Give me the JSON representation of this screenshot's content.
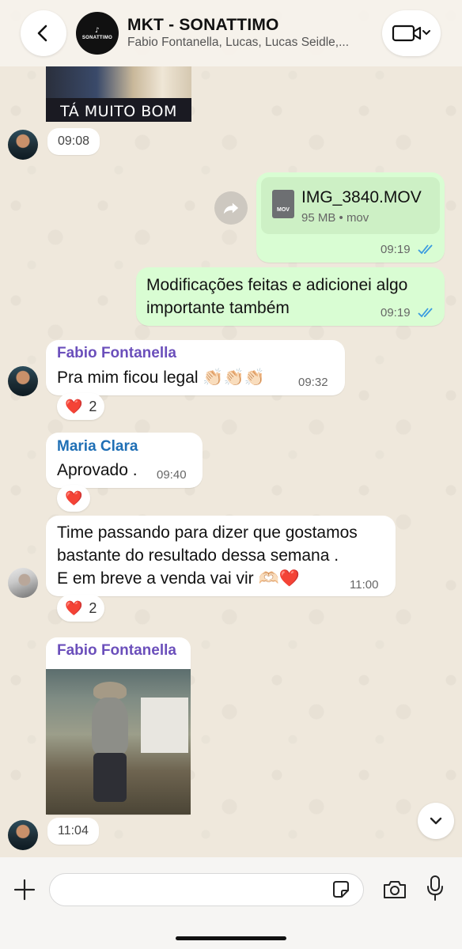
{
  "header": {
    "title": "MKT - SONATTIMO",
    "subtitle": "Fabio Fontanella, Lucas, Lucas Seidle,...",
    "avatar_text": "SONATTIMO"
  },
  "messages": {
    "gif_caption": "TÁ MUITO BOM",
    "gif_time": "09:08",
    "file": {
      "badge": "MOV",
      "name": "IMG_3840.MOV",
      "meta": "95 MB • mov",
      "time": "09:19"
    },
    "out_text": {
      "text_line1": "Modificações feitas e adicionei algo",
      "text_line2": "importante também",
      "time": "09:19"
    },
    "fabio1": {
      "sender": "Fabio Fontanella",
      "text": "Pra mim ficou legal 👏🏻👏🏻👏🏻",
      "time": "09:32",
      "reaction_emoji": "❤️",
      "reaction_count": "2"
    },
    "maria": {
      "sender": "Maria Clara",
      "text": "Aprovado .",
      "time": "09:40",
      "reaction_emoji": "❤️"
    },
    "team": {
      "line1": "Time passando para dizer que gostamos",
      "line2": "bastante do resultado dessa semana .",
      "line3": "E em breve a venda vai vir 🫶🏻❤️",
      "time": "11:00",
      "reaction_emoji": "❤️",
      "reaction_count": "2"
    },
    "fabio2": {
      "sender": "Fabio Fontanella",
      "time": "11:04"
    }
  },
  "colors": {
    "fabio_name": "#6b4fbb",
    "maria_name": "#1f6fb5",
    "outgoing_bubble": "#d9fdd3",
    "read_ticks": "#3b9be0"
  },
  "icons": [
    "back-icon",
    "video-call-icon",
    "forward-icon",
    "file-icon",
    "read-ticks-icon",
    "plus-icon",
    "sticker-icon",
    "camera-icon",
    "microphone-icon",
    "chevron-down-icon"
  ],
  "input": {
    "placeholder": ""
  }
}
